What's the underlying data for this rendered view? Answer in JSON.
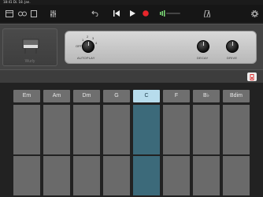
{
  "status": {
    "time": "18:41",
    "date": "Di. 18. Jan.",
    "right": ""
  },
  "toolbar": {
    "icons": [
      "my-songs-icon",
      "browser-icon",
      "tracks-view-icon",
      "mixer-icon",
      "undo-icon",
      "rewind-icon",
      "play-icon",
      "record-icon",
      "master-volume-icon",
      "metronome-icon",
      "settings-icon"
    ]
  },
  "instrument": {
    "name": "Wurly",
    "autoplay_label": "AUTOPLAY",
    "autoplay_off": "OFF",
    "autoplay_ticks": [
      "1",
      "2",
      "3",
      "4"
    ],
    "decay_label": "DECAY",
    "drive_label": "DRIVE"
  },
  "chords": [
    {
      "label": "Em"
    },
    {
      "label": "Am"
    },
    {
      "label": "Dm"
    },
    {
      "label": "G"
    },
    {
      "label": "C",
      "active": true
    },
    {
      "label": "F"
    },
    {
      "label": "B♭"
    },
    {
      "label": "Bdim"
    }
  ],
  "colors": {
    "accent": "#b7dcec",
    "record": "#e8262b",
    "active_pad": "#3c6a7a"
  }
}
